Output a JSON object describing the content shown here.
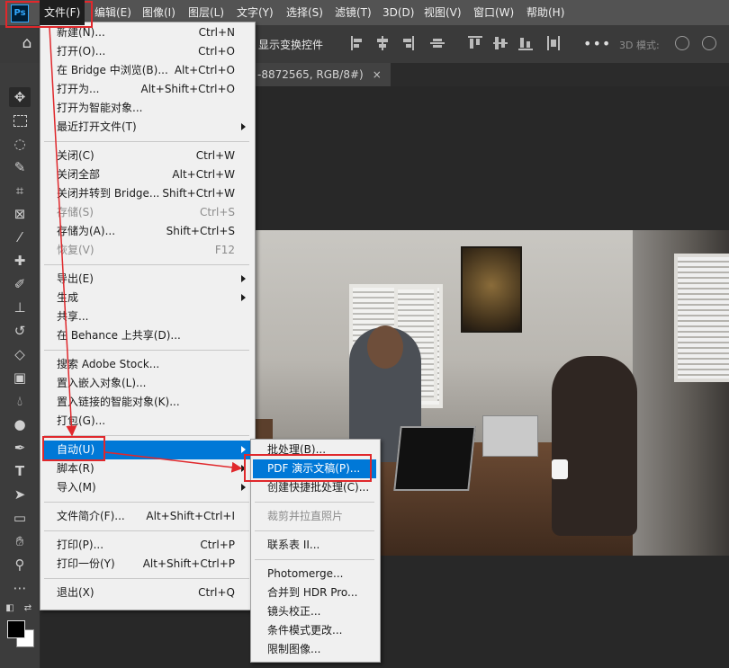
{
  "app": {
    "logo_text": "Ps"
  },
  "menubar": {
    "items": [
      "文件(F)",
      "编辑(E)",
      "图像(I)",
      "图层(L)",
      "文字(Y)",
      "选择(S)",
      "滤镜(T)",
      "3D(D)",
      "视图(V)",
      "窗口(W)",
      "帮助(H)"
    ]
  },
  "options_bar": {
    "show_transform_controls": "显示变换控件",
    "mode_3d": "3D 模式:"
  },
  "document_tab": {
    "title": "-8872565, RGB/8#)",
    "close": "×"
  },
  "file_menu": {
    "groups": [
      [
        {
          "label": "新建(N)...",
          "shortcut": "Ctrl+N"
        },
        {
          "label": "打开(O)...",
          "shortcut": "Ctrl+O"
        },
        {
          "label": "在 Bridge 中浏览(B)...",
          "shortcut": "Alt+Ctrl+O"
        },
        {
          "label": "打开为...",
          "shortcut": "Alt+Shift+Ctrl+O"
        },
        {
          "label": "打开为智能对象...",
          "shortcut": ""
        },
        {
          "label": "最近打开文件(T)",
          "shortcut": "",
          "submenu": true
        }
      ],
      [
        {
          "label": "关闭(C)",
          "shortcut": "Ctrl+W"
        },
        {
          "label": "关闭全部",
          "shortcut": "Alt+Ctrl+W"
        },
        {
          "label": "关闭并转到 Bridge...",
          "shortcut": "Shift+Ctrl+W"
        },
        {
          "label": "存储(S)",
          "shortcut": "Ctrl+S",
          "disabled": true
        },
        {
          "label": "存储为(A)...",
          "shortcut": "Shift+Ctrl+S"
        },
        {
          "label": "恢复(V)",
          "shortcut": "F12",
          "disabled": true
        }
      ],
      [
        {
          "label": "导出(E)",
          "shortcut": "",
          "submenu": true
        },
        {
          "label": "生成",
          "shortcut": "",
          "submenu": true
        },
        {
          "label": "共享...",
          "shortcut": ""
        },
        {
          "label": "在 Behance 上共享(D)...",
          "shortcut": ""
        }
      ],
      [
        {
          "label": "搜索 Adobe Stock...",
          "shortcut": ""
        },
        {
          "label": "置入嵌入对象(L)...",
          "shortcut": ""
        },
        {
          "label": "置入链接的智能对象(K)...",
          "shortcut": ""
        },
        {
          "label": "打包(G)...",
          "shortcut": ""
        }
      ],
      [
        {
          "label": "自动(U)",
          "shortcut": "",
          "submenu": true,
          "highlighted": true
        },
        {
          "label": "脚本(R)",
          "shortcut": "",
          "submenu": true
        },
        {
          "label": "导入(M)",
          "shortcut": "",
          "submenu": true
        }
      ],
      [
        {
          "label": "文件简介(F)...",
          "shortcut": "Alt+Shift+Ctrl+I"
        }
      ],
      [
        {
          "label": "打印(P)...",
          "shortcut": "Ctrl+P"
        },
        {
          "label": "打印一份(Y)",
          "shortcut": "Alt+Shift+Ctrl+P"
        }
      ],
      [
        {
          "label": "退出(X)",
          "shortcut": "Ctrl+Q"
        }
      ]
    ]
  },
  "automate_menu": {
    "groups": [
      [
        {
          "label": "批处理(B)..."
        },
        {
          "label": "PDF 演示文稿(P)...",
          "highlighted": true
        },
        {
          "label": "创建快捷批处理(C)..."
        }
      ],
      [
        {
          "label": "裁剪并拉直照片",
          "disabled": true
        }
      ],
      [
        {
          "label": "联系表 II..."
        }
      ],
      [
        {
          "label": "Photomerge..."
        },
        {
          "label": "合并到 HDR Pro..."
        },
        {
          "label": "镜头校正..."
        },
        {
          "label": "条件模式更改..."
        },
        {
          "label": "限制图像..."
        }
      ]
    ]
  },
  "colors": {
    "highlight": "#0078d7",
    "annotation": "#e0282c",
    "menubar_bg": "#535353",
    "menu_bg": "#f0f0f0"
  },
  "icons": {
    "tools": [
      "move-tool-icon",
      "marquee-tool-icon",
      "lasso-tool-icon",
      "quick-select-tool-icon",
      "crop-tool-icon",
      "frame-tool-icon",
      "eyedropper-tool-icon",
      "healing-brush-tool-icon",
      "brush-tool-icon",
      "clone-stamp-tool-icon",
      "history-brush-tool-icon",
      "eraser-tool-icon",
      "gradient-tool-icon",
      "blur-tool-icon",
      "dodge-tool-icon",
      "pen-tool-icon",
      "type-tool-icon",
      "path-select-tool-icon",
      "rectangle-tool-icon",
      "hand-tool-icon",
      "zoom-tool-icon",
      "more-tools-icon"
    ]
  }
}
